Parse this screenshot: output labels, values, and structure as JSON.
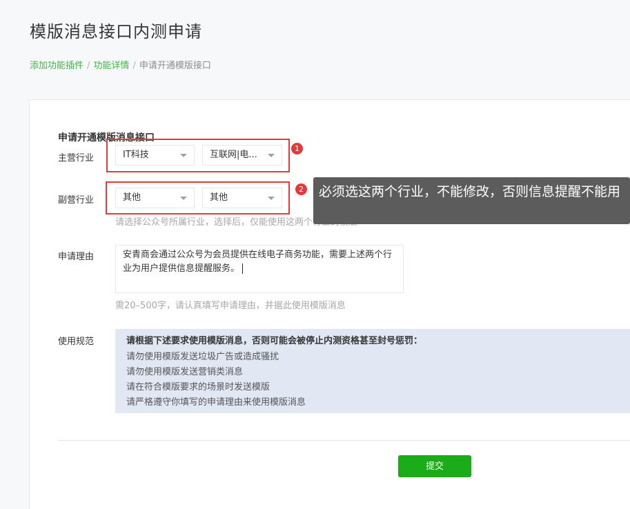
{
  "page": {
    "title": "模版消息接口内测申请"
  },
  "breadcrumb": {
    "items": [
      "添加功能插件",
      "功能详情",
      "申请开通模版接口"
    ],
    "separator": "/"
  },
  "form": {
    "section_title": "申请开通模版消息接口",
    "main_industry": {
      "label": "主营行业",
      "primary": "IT科技",
      "secondary": "互联网|电..."
    },
    "sub_industry": {
      "label": "副营行业",
      "primary": "其他",
      "secondary": "其他",
      "hint": "请选择公众号所属行业，选择后，仅能使用这两个行业的模版"
    },
    "reason": {
      "label": "申请理由",
      "value": "安青商会通过公众号为会员提供在线电子商务功能，需要上述两个行业为用户提供信息提醒服务。",
      "hint": "需20–500字，请认真填写申请理由，并据此使用模版消息"
    },
    "rules": {
      "label": "使用规范",
      "heading": "请根据下述要求使用模版消息，否则可能会被停止内测资格甚至封号惩罚：",
      "items": [
        "请勿使用模版发送垃圾广告或造成骚扰",
        "请勿使用模版发送营销类消息",
        "请在符合模版要求的场景时发送模版",
        "请严格遵守你填写的申请理由来使用模版消息"
      ]
    },
    "submit_label": "提交"
  },
  "annotations": {
    "badge_1": "1",
    "badge_2": "2",
    "tooltip": "必须选这两个行业，不能修改，否则信息提醒不能用",
    "highlight_color": "#e4393c"
  },
  "colors": {
    "accent_green": "#1aad19",
    "link_green": "#44b549",
    "rules_bg": "#e1e7f3"
  }
}
